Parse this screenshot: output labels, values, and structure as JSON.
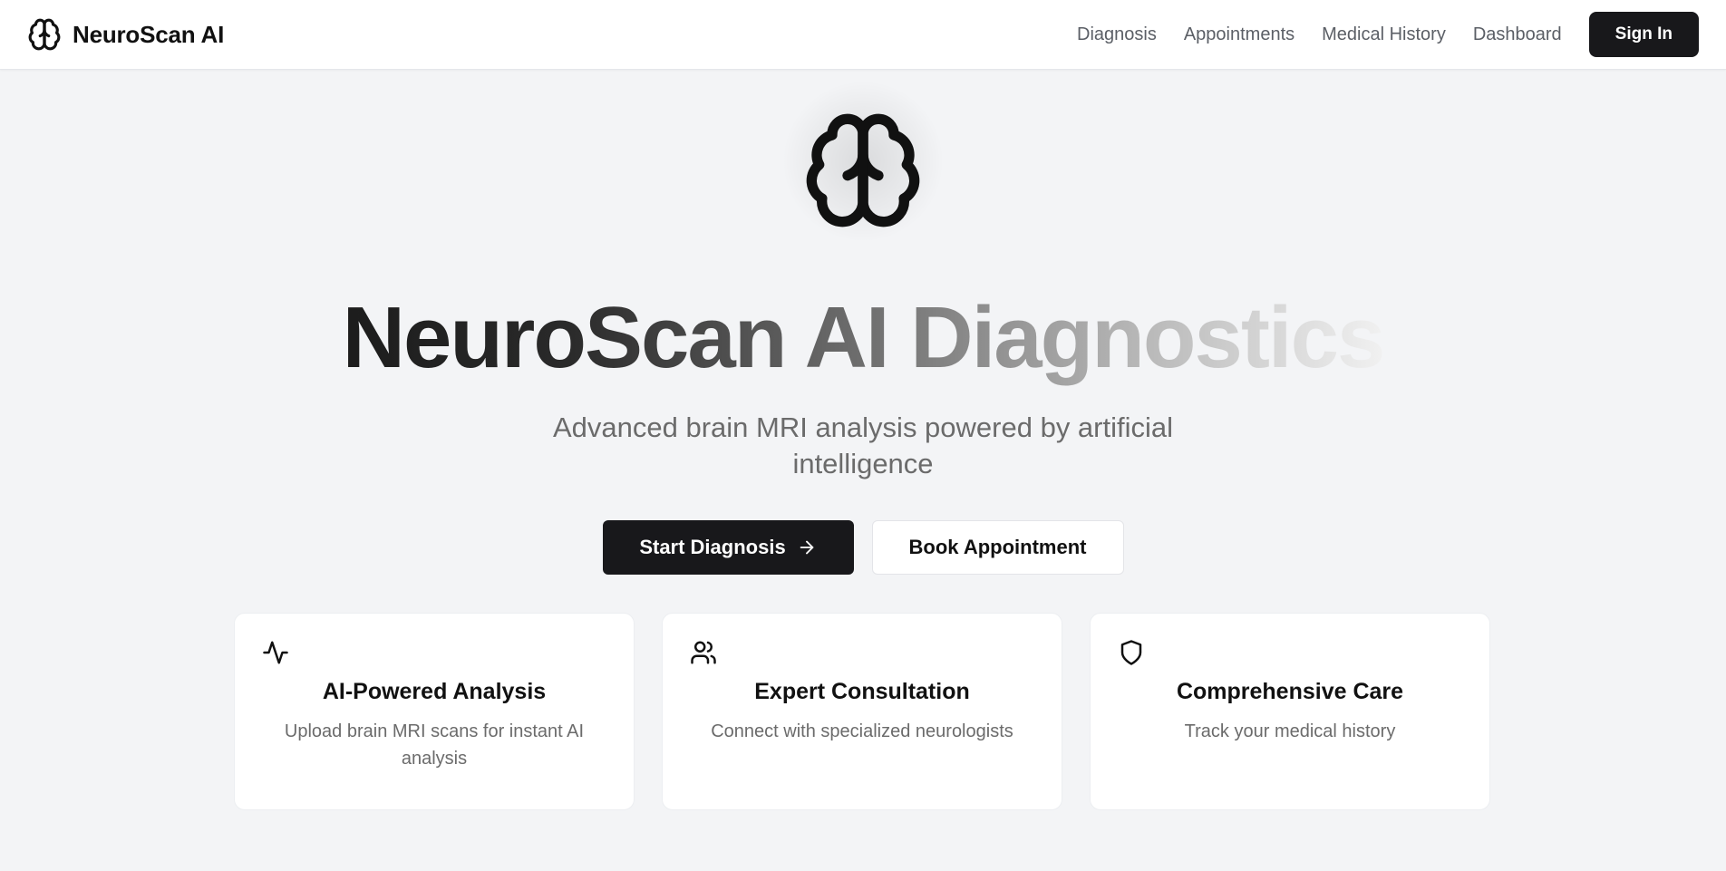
{
  "header": {
    "brand": "NeuroScan AI",
    "nav": [
      {
        "label": "Diagnosis"
      },
      {
        "label": "Appointments"
      },
      {
        "label": "Medical History"
      },
      {
        "label": "Dashboard"
      }
    ],
    "signin_label": "Sign In"
  },
  "hero": {
    "icon": "brain-icon",
    "title": "NeuroScan AI Diagnostics",
    "subtitle": "Advanced brain MRI analysis powered by artificial intelligence",
    "primary_cta": "Start Diagnosis",
    "secondary_cta": "Book Appointment"
  },
  "features": [
    {
      "icon": "activity-icon",
      "title": "AI-Powered Analysis",
      "description": "Upload brain MRI scans for instant AI analysis"
    },
    {
      "icon": "users-icon",
      "title": "Expert Consultation",
      "description": "Connect with specialized neurologists"
    },
    {
      "icon": "shield-icon",
      "title": "Comprehensive Care",
      "description": "Track your medical history"
    }
  ],
  "colors": {
    "background": "#f3f4f6",
    "primary": "#18181b",
    "muted_text": "#6b6b6b",
    "card": "#ffffff"
  }
}
